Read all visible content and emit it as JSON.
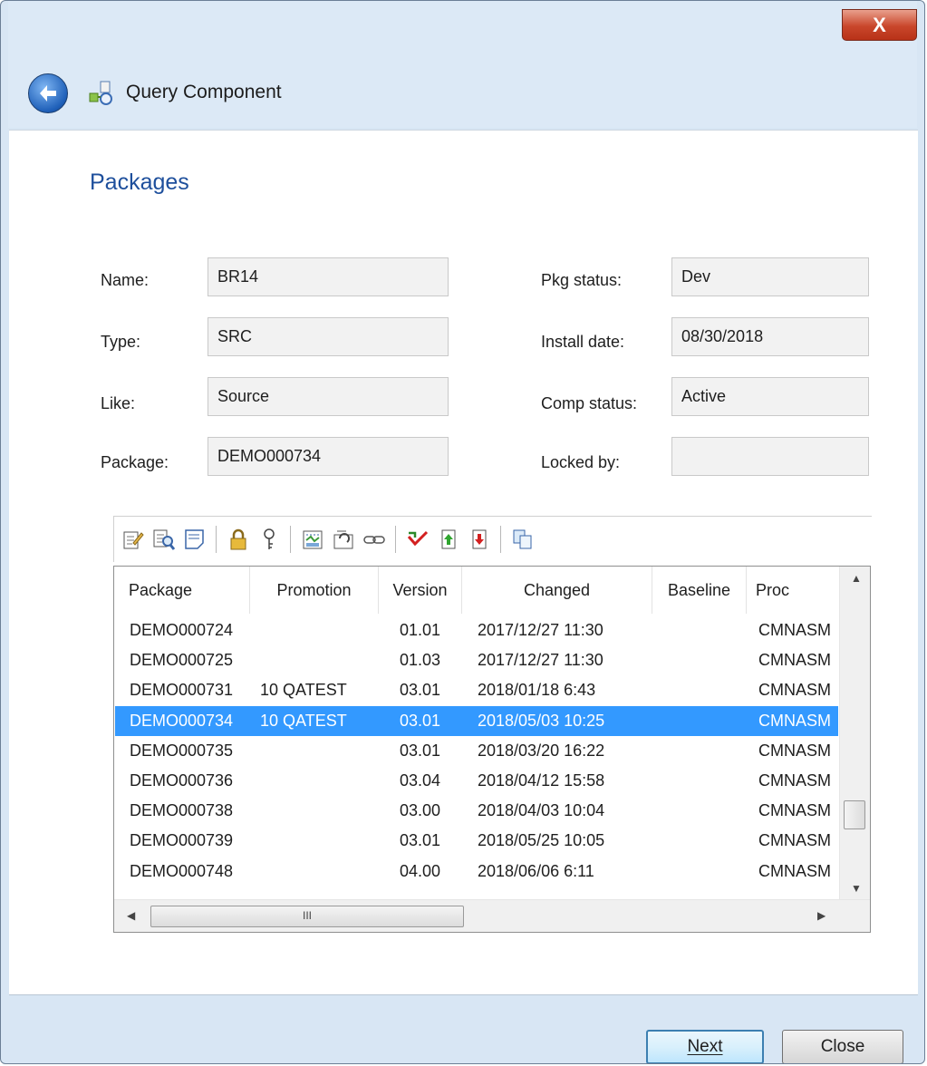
{
  "window": {
    "title": "Query Component",
    "close_glyph": "X"
  },
  "page": {
    "section_title": "Packages"
  },
  "form": {
    "name_label": "Name:",
    "name_value": "BR14",
    "type_label": "Type:",
    "type_value": "SRC",
    "like_label": "Like:",
    "like_value": "Source",
    "package_label": "Package:",
    "package_value": "DEMO000734",
    "pkg_status_label": "Pkg status:",
    "pkg_status_value": "Dev",
    "install_date_label": "Install date:",
    "install_date_value": "08/30/2018",
    "comp_status_label": "Comp status:",
    "comp_status_value": "Active",
    "locked_by_label": "Locked by:",
    "locked_by_value": ""
  },
  "toolbar": {
    "icons": [
      "edit-icon",
      "browse-icon",
      "notes-icon",
      "lock-icon",
      "key-icon",
      "compare-icon",
      "recompile-icon",
      "link-icon",
      "checkout-icon",
      "promote-icon",
      "demote-icon",
      "copy-icon"
    ]
  },
  "grid": {
    "columns": [
      "Package",
      "Promotion",
      "Version",
      "Changed",
      "Baseline",
      "Proc"
    ],
    "rows": [
      {
        "package": "DEMO000724",
        "promotion": "",
        "version": "01.01",
        "changed": "2017/12/27  11:30",
        "baseline": "",
        "proc": "CMNASM"
      },
      {
        "package": "DEMO000725",
        "promotion": "",
        "version": "01.03",
        "changed": "2017/12/27  11:30",
        "baseline": "",
        "proc": "CMNASM"
      },
      {
        "package": "DEMO000731",
        "promotion": "10 QATEST",
        "version": "03.01",
        "changed": "2018/01/18  6:43",
        "baseline": "",
        "proc": "CMNASM"
      },
      {
        "package": "DEMO000734",
        "promotion": "10 QATEST",
        "version": "03.01",
        "changed": "2018/05/03  10:25",
        "baseline": "",
        "proc": "CMNASM",
        "selected": true
      },
      {
        "package": "DEMO000735",
        "promotion": "",
        "version": "03.01",
        "changed": "2018/03/20  16:22",
        "baseline": "",
        "proc": "CMNASM"
      },
      {
        "package": "DEMO000736",
        "promotion": "",
        "version": "03.04",
        "changed": "2018/04/12  15:58",
        "baseline": "",
        "proc": "CMNASM"
      },
      {
        "package": "DEMO000738",
        "promotion": "",
        "version": "03.00",
        "changed": "2018/04/03  10:04",
        "baseline": "",
        "proc": "CMNASM"
      },
      {
        "package": "DEMO000739",
        "promotion": "",
        "version": "03.01",
        "changed": "2018/05/25  10:05",
        "baseline": "",
        "proc": "CMNASM"
      },
      {
        "package": "DEMO000748",
        "promotion": "",
        "version": "04.00",
        "changed": "2018/06/06  6:11",
        "baseline": "",
        "proc": "CMNASM"
      }
    ],
    "hscroll_grip": "III"
  },
  "buttons": {
    "next_label": "Next",
    "close_label": "Close"
  },
  "colors": {
    "selection": "#3399ff",
    "section_title": "#1e4f9c",
    "close_button": "#c9462b"
  }
}
